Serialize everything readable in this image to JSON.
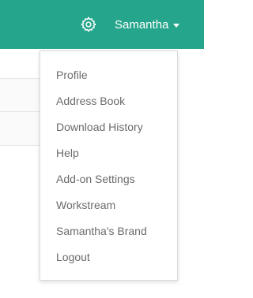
{
  "header": {
    "background_color": "#25a58b",
    "settings_icon": "gear-icon",
    "user_name": "Samantha",
    "user_caret_icon": "caret-down-icon"
  },
  "user_menu": {
    "items": [
      {
        "label": "Profile"
      },
      {
        "label": "Address Book"
      },
      {
        "label": "Download History"
      },
      {
        "label": "Help"
      },
      {
        "label": "Add-on Settings"
      },
      {
        "label": "Workstream"
      },
      {
        "label": "Samantha's Brand"
      },
      {
        "label": "Logout"
      }
    ]
  }
}
